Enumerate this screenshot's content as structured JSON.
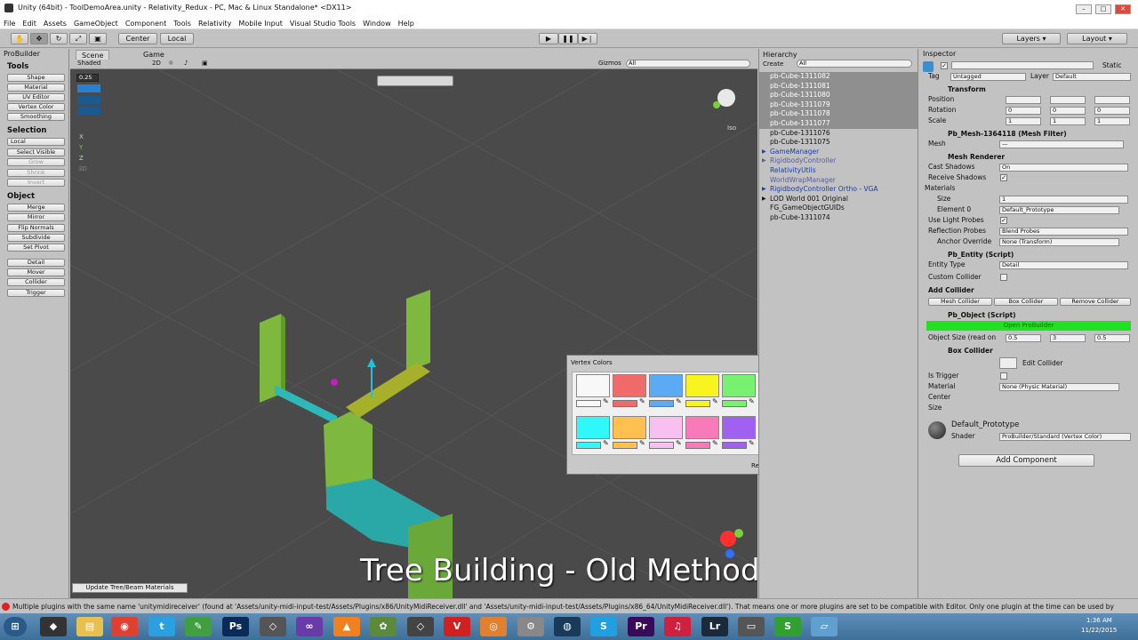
{
  "window": {
    "title": "Unity (64bit) - ToolDemoArea.unity - Relativity_Redux - PC, Mac & Linux Standalone* <DX11>"
  },
  "menu": [
    "File",
    "Edit",
    "Assets",
    "GameObject",
    "Component",
    "Tools",
    "Relativity",
    "Mobile Input",
    "Visual Studio Tools",
    "Window",
    "Help"
  ],
  "toolbar": {
    "center": "Center",
    "local": "Local",
    "layers": "Layers",
    "layout": "Layout"
  },
  "probuilder": {
    "tab": "ProBuilder",
    "tools_header": "Tools",
    "tools": [
      "Shape",
      "Material",
      "UV Editor",
      "Vertex Color",
      "Smoothing"
    ],
    "selection_header": "Selection",
    "selection": [
      "Local",
      "Select Visible",
      "Grow",
      "Shrink",
      "Invert"
    ],
    "object_header": "Object",
    "object": [
      "Merge",
      "Mirror",
      "Flip Normals",
      "Subdivide",
      "Set Pivot"
    ],
    "entities": [
      "Detail",
      "Mover",
      "Collider",
      "Trigger"
    ]
  },
  "scene": {
    "tab_scene": "Scene",
    "tab_game": "Game",
    "shaded": "Shaded",
    "twod": "2D",
    "gizmos": "Gizmos",
    "search": "All",
    "snap": "0.25",
    "iso": "Iso",
    "axis_x": "X",
    "axis_y": "Y",
    "axis_z": "Z",
    "threed": "3D",
    "update_btn": "Update Tree/Beam Materials",
    "overlay": "Tree Building - Old Method"
  },
  "vertex_colors": {
    "title": "Vertex Colors",
    "reset": "Reset",
    "row1": [
      "#f8f8f8",
      "#f06a6a",
      "#5aaaf5",
      "#f8f420",
      "#78f070"
    ],
    "row2": [
      "#30f8f8",
      "#ffc050",
      "#f8c0f0",
      "#f87ab8",
      "#a060f0"
    ]
  },
  "hierarchy": {
    "title": "Hierarchy",
    "create": "Create",
    "search": "All",
    "items": [
      {
        "label": "pb-Cube-1311082",
        "style": "sel"
      },
      {
        "label": "pb-Cube-1311081",
        "style": "sel"
      },
      {
        "label": "pb-Cube-1311080",
        "style": "sel"
      },
      {
        "label": "pb-Cube-1311079",
        "style": "sel"
      },
      {
        "label": "pb-Cube-1311078",
        "style": "sel"
      },
      {
        "label": "pb-Cube-1311077",
        "style": "sel"
      },
      {
        "label": "pb-Cube-1311076",
        "style": ""
      },
      {
        "label": "pb-Cube-1311075",
        "style": ""
      },
      {
        "label": "GameManager",
        "style": "blue",
        "arrow": "▶"
      },
      {
        "label": "RigidbodyController",
        "style": "gray",
        "arrow": "▶"
      },
      {
        "label": "RelativityUtils",
        "style": "blue"
      },
      {
        "label": "WorldWrapManager",
        "style": "gray"
      },
      {
        "label": "RigidbodyController Ortho - VGA",
        "style": "blue",
        "arrow": "▶"
      },
      {
        "label": "LOD World 001 Original",
        "style": "",
        "arrow": "▶"
      },
      {
        "label": "FG_GameObjectGUIDs",
        "style": ""
      },
      {
        "label": "pb-Cube-1311074",
        "style": ""
      }
    ]
  },
  "inspector": {
    "title": "Inspector",
    "static": "Static",
    "tag_label": "Tag",
    "tag": "Untagged",
    "layer_label": "Layer",
    "layer": "Default",
    "transform": "Transform",
    "position": "Position",
    "rotation": "Rotation",
    "scale": "Scale",
    "pos": [
      "",
      "",
      ""
    ],
    "rot": [
      "0",
      "0",
      "0"
    ],
    "scl": [
      "1",
      "1",
      "1"
    ],
    "mesh_filter": "Pb_Mesh-1364118 (Mesh Filter)",
    "mesh": "Mesh",
    "mesh_val": "—",
    "mesh_renderer": "Mesh Renderer",
    "cast_shadows": "Cast Shadows",
    "cast_val": "On",
    "receive_shadows": "Receive Shadows",
    "materials": "Materials",
    "size": "Size",
    "size_val": "1",
    "element0": "Element 0",
    "element0_val": "Default_Prototype",
    "light_probes": "Use Light Probes",
    "reflection_probes": "Reflection Probes",
    "reflection_val": "Blend Probes",
    "anchor": "Anchor Override",
    "anchor_val": "None (Transform)",
    "entity": "Pb_Entity (Script)",
    "entity_type": "Entity Type",
    "entity_val": "Detail",
    "custom_collider": "Custom Collider",
    "add_collider": "Add Collider",
    "mesh_collider": "Mesh Collider",
    "box_collider_btn": "Box Collider",
    "remove_collider": "Remove Collider",
    "pb_object": "Pb_Object (Script)",
    "open_pb": "Open ProBuilder",
    "object_size": "Object Size (read on",
    "os": [
      "0.5",
      "3",
      "0.5"
    ],
    "box_collider": "Box Collider",
    "edit_collider": "Edit Collider",
    "is_trigger": "Is Trigger",
    "material": "Material",
    "material_val": "None (Physic Material)",
    "center": "Center",
    "bsize": "Size",
    "mat_name": "Default_Prototype",
    "shader": "Shader",
    "shader_val": "ProBuilder/Standard (Vertex Color)",
    "add_component": "Add Component"
  },
  "console": "Multiple plugins with the same name 'unitymidireceiver' (found at 'Assets/unity-midi-input-test/Assets/Plugins/x86/UnityMidiReceiver.dll' and 'Assets/unity-midi-input-test/Assets/Plugins/x86_64/UnityMidiReceiver.dll'). That means one or more plugins are set to be compatible with Editor. Only one plugin at the time can be used by",
  "taskbar": {
    "time": "1:36 AM",
    "date": "11/22/2015"
  }
}
